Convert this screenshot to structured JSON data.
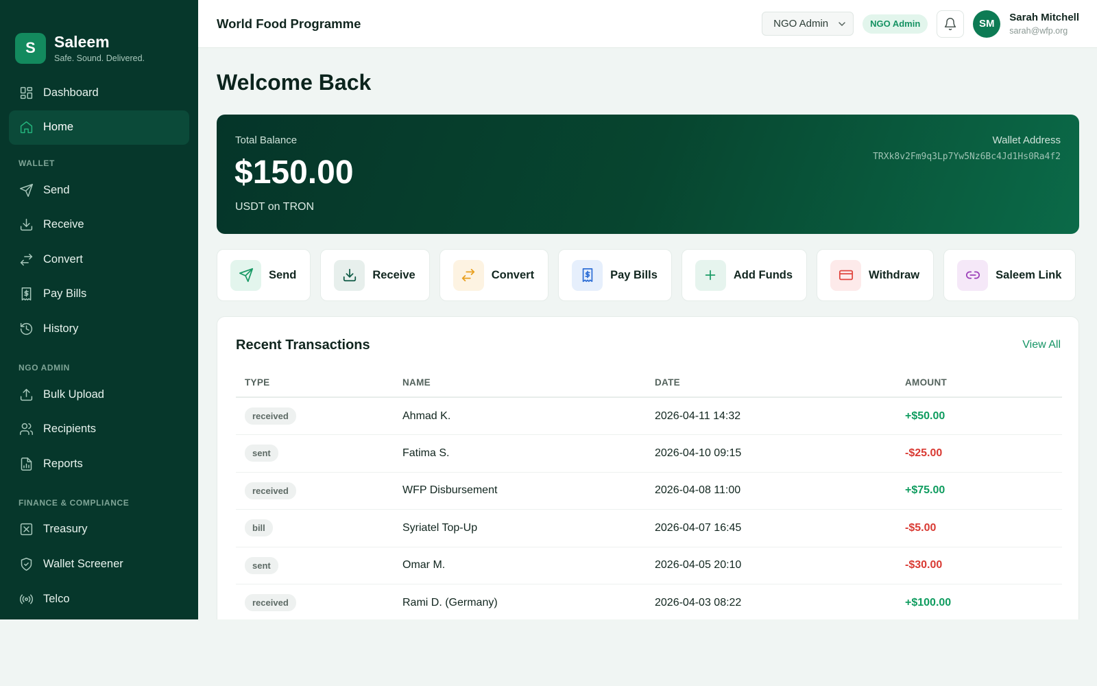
{
  "brand": {
    "logo_letter": "S",
    "name": "Saleem",
    "tagline": "Safe. Sound. Delivered."
  },
  "sidebar": {
    "top_items": [
      {
        "label": "Dashboard",
        "icon": "dashboard-icon"
      },
      {
        "label": "Home",
        "icon": "home-icon",
        "active": true
      }
    ],
    "sections": [
      {
        "title": "WALLET",
        "items": [
          {
            "label": "Send",
            "icon": "send-icon"
          },
          {
            "label": "Receive",
            "icon": "receive-icon"
          },
          {
            "label": "Convert",
            "icon": "convert-icon"
          },
          {
            "label": "Pay Bills",
            "icon": "bill-icon"
          },
          {
            "label": "History",
            "icon": "history-icon"
          }
        ]
      },
      {
        "title": "NGO ADMIN",
        "items": [
          {
            "label": "Bulk Upload",
            "icon": "upload-icon"
          },
          {
            "label": "Recipients",
            "icon": "users-icon"
          },
          {
            "label": "Reports",
            "icon": "report-icon"
          }
        ]
      },
      {
        "title": "FINANCE & COMPLIANCE",
        "items": [
          {
            "label": "Treasury",
            "icon": "treasury-icon"
          },
          {
            "label": "Wallet Screener",
            "icon": "shield-icon"
          },
          {
            "label": "Telco",
            "icon": "broadcast-icon"
          }
        ]
      }
    ]
  },
  "header": {
    "org_title": "World Food Programme",
    "role_select_value": "NGO Admin",
    "role_badge": "NGO Admin",
    "user_initials": "SM",
    "user_name": "Sarah Mitchell",
    "user_email": "sarah@wfp.org"
  },
  "main": {
    "title": "Welcome Back",
    "balance": {
      "label": "Total Balance",
      "amount": "$150.00",
      "network": "USDT on TRON",
      "wallet_label": "Wallet Address",
      "wallet_address": "TRXk8v2Fm9q3Lp7Yw5Nz6Bc4Jd1Hs0Ra4f2"
    },
    "actions": [
      {
        "label": "Send",
        "icon": "send-icon",
        "color": "#1a9a66",
        "bg": "#e3f5ed"
      },
      {
        "label": "Receive",
        "icon": "receive-icon",
        "color": "#0f5a45",
        "bg": "#e7efec"
      },
      {
        "label": "Convert",
        "icon": "convert-icon",
        "color": "#e8a021",
        "bg": "#fdf3e2"
      },
      {
        "label": "Pay Bills",
        "icon": "bill-icon",
        "color": "#2f6fd6",
        "bg": "#e6effc"
      },
      {
        "label": "Add Funds",
        "icon": "plus-icon",
        "color": "#1a9a66",
        "bg": "#e6f4ee"
      },
      {
        "label": "Withdraw",
        "icon": "card-icon",
        "color": "#e0453e",
        "bg": "#fdeaea"
      },
      {
        "label": "Saleem Link",
        "icon": "link-icon",
        "color": "#9b3fb8",
        "bg": "#f5e8f8"
      }
    ],
    "transactions": {
      "title": "Recent Transactions",
      "view_all": "View All",
      "columns": [
        "TYPE",
        "NAME",
        "DATE",
        "AMOUNT"
      ],
      "rows": [
        {
          "type": "received",
          "name": "Ahmad K.",
          "date": "2026-04-11 14:32",
          "amount": "+$50.00"
        },
        {
          "type": "sent",
          "name": "Fatima S.",
          "date": "2026-04-10 09:15",
          "amount": "-$25.00"
        },
        {
          "type": "received",
          "name": "WFP Disbursement",
          "date": "2026-04-08 11:00",
          "amount": "+$75.00"
        },
        {
          "type": "bill",
          "name": "Syriatel Top-Up",
          "date": "2026-04-07 16:45",
          "amount": "-$5.00"
        },
        {
          "type": "sent",
          "name": "Omar M.",
          "date": "2026-04-05 20:10",
          "amount": "-$30.00"
        },
        {
          "type": "received",
          "name": "Rami D. (Germany)",
          "date": "2026-04-03 08:22",
          "amount": "+$100.00"
        }
      ]
    }
  }
}
